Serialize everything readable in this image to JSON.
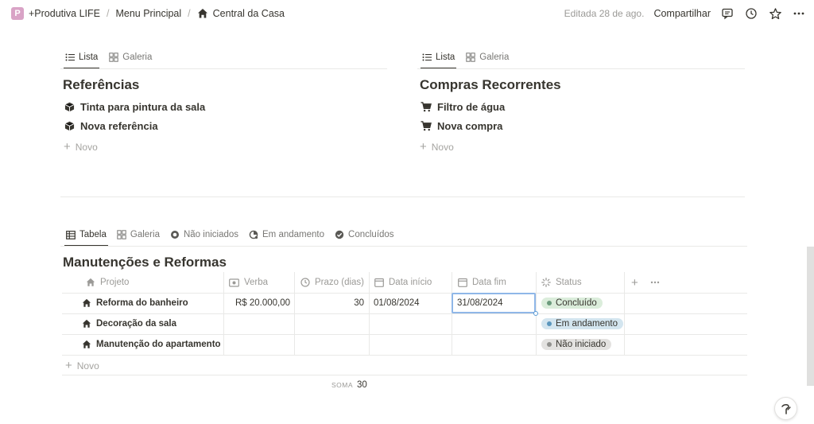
{
  "breadcrumb": {
    "app_letter": "P",
    "items": [
      "+Produtiva LIFE",
      "Menu Principal",
      "Central da Casa"
    ],
    "separator": "/"
  },
  "topbar": {
    "edited": "Editada 28 de ago.",
    "share": "Compartilhar",
    "icons": [
      "comment-icon",
      "clock-icon",
      "star-icon",
      "more-icon"
    ]
  },
  "referencias": {
    "tabs": [
      "Lista",
      "Galeria"
    ],
    "title": "Referências",
    "items": [
      "Tinta para pintura da sala",
      "Nova referência"
    ],
    "new_label": "Novo"
  },
  "compras": {
    "tabs": [
      "Lista",
      "Galeria"
    ],
    "title": "Compras Recorrentes",
    "items": [
      "Filtro de água",
      "Nova compra"
    ],
    "new_label": "Novo"
  },
  "manutencoes": {
    "tabs": [
      "Tabela",
      "Galeria",
      "Não iniciados",
      "Em andamento",
      "Concluídos"
    ],
    "title": "Manutenções e Reformas",
    "columns": [
      "Projeto",
      "Verba",
      "Prazo (dias)",
      "Data início",
      "Data fim",
      "Status"
    ],
    "rows": [
      {
        "projeto": "Reforma do banheiro",
        "verba": "R$ 20.000,00",
        "prazo": "30",
        "inicio": "01/08/2024",
        "fim": "31/08/2024",
        "status": "Concluído"
      },
      {
        "projeto": "Decoração da sala",
        "verba": "",
        "prazo": "",
        "inicio": "",
        "fim": "",
        "status": "Em andamento"
      },
      {
        "projeto": "Manutenção do apartamento",
        "verba": "",
        "prazo": "",
        "inicio": "",
        "fim": "",
        "status": "Não iniciado"
      }
    ],
    "new_label": "Novo",
    "sum_label": "SOMA",
    "sum_value": "30"
  },
  "status_colors": {
    "Concluído": {
      "bg": "#dbeddb",
      "dot": "#6c9b7d"
    },
    "Em andamento": {
      "bg": "#d3e5ef",
      "dot": "#5b97bd"
    },
    "Não iniciado": {
      "bg": "#e3e2e0",
      "dot": "#91918e"
    }
  }
}
